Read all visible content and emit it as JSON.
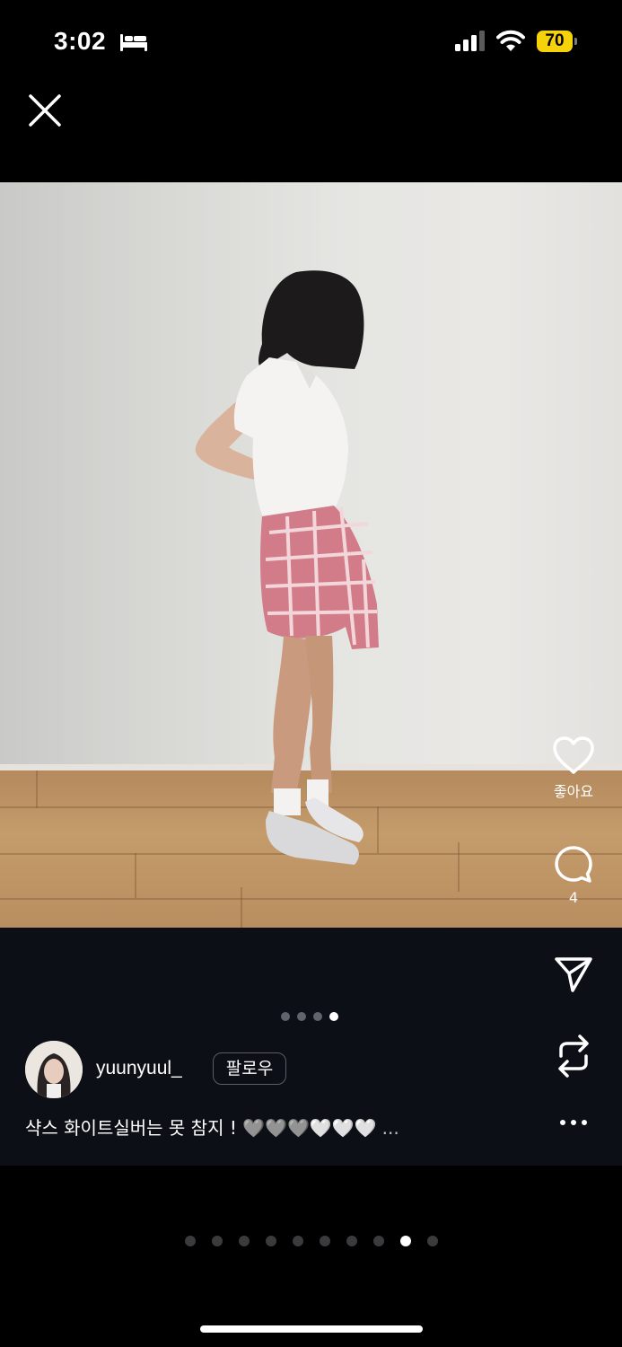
{
  "status_bar": {
    "time": "3:02",
    "battery_level": "70",
    "battery_color": "#f5d20a"
  },
  "icons": {
    "close": "close-icon",
    "like": "heart-icon",
    "comment": "comment-bubble-icon",
    "share": "paper-plane-icon",
    "remix": "repost-icon",
    "more": "ellipsis-icon"
  },
  "actions": {
    "like_label": "좋아요",
    "comment_count": "4"
  },
  "post": {
    "username": "yuunyuul_",
    "follow_label": "팔로우",
    "caption": "샥스 화이트실버는 못 참지 ! 🩶🩶🩶🤍🤍🤍",
    "caption_more": "...",
    "carousel": {
      "count": 4,
      "active_index": 3
    }
  },
  "pager": {
    "count": 10,
    "active_index": 8
  }
}
